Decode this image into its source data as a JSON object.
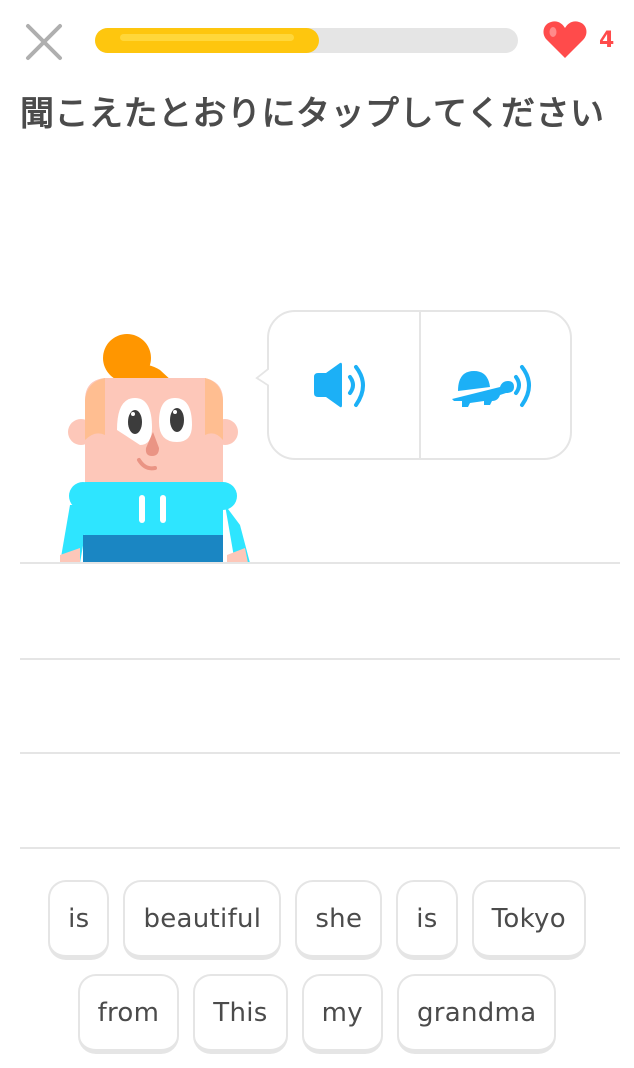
{
  "header": {
    "close_icon": "close-x-icon",
    "progress_percent": 53,
    "hearts_icon": "heart-icon",
    "hearts_count": "4",
    "colors": {
      "progress": "#fec60e",
      "progress_track": "#e5e5e5",
      "heart": "#ff4b4b"
    }
  },
  "prompt": {
    "title": "聞こえたとおりにタップしてください"
  },
  "audio": {
    "normal_icon": "speaker-icon",
    "slow_icon": "turtle-speaker-icon",
    "color": "#1cb0f6"
  },
  "word_bank": {
    "rows": [
      [
        "is",
        "beautiful",
        "she",
        "is",
        "Tokyo"
      ],
      [
        "from",
        "This",
        "my",
        "grandma"
      ]
    ]
  }
}
